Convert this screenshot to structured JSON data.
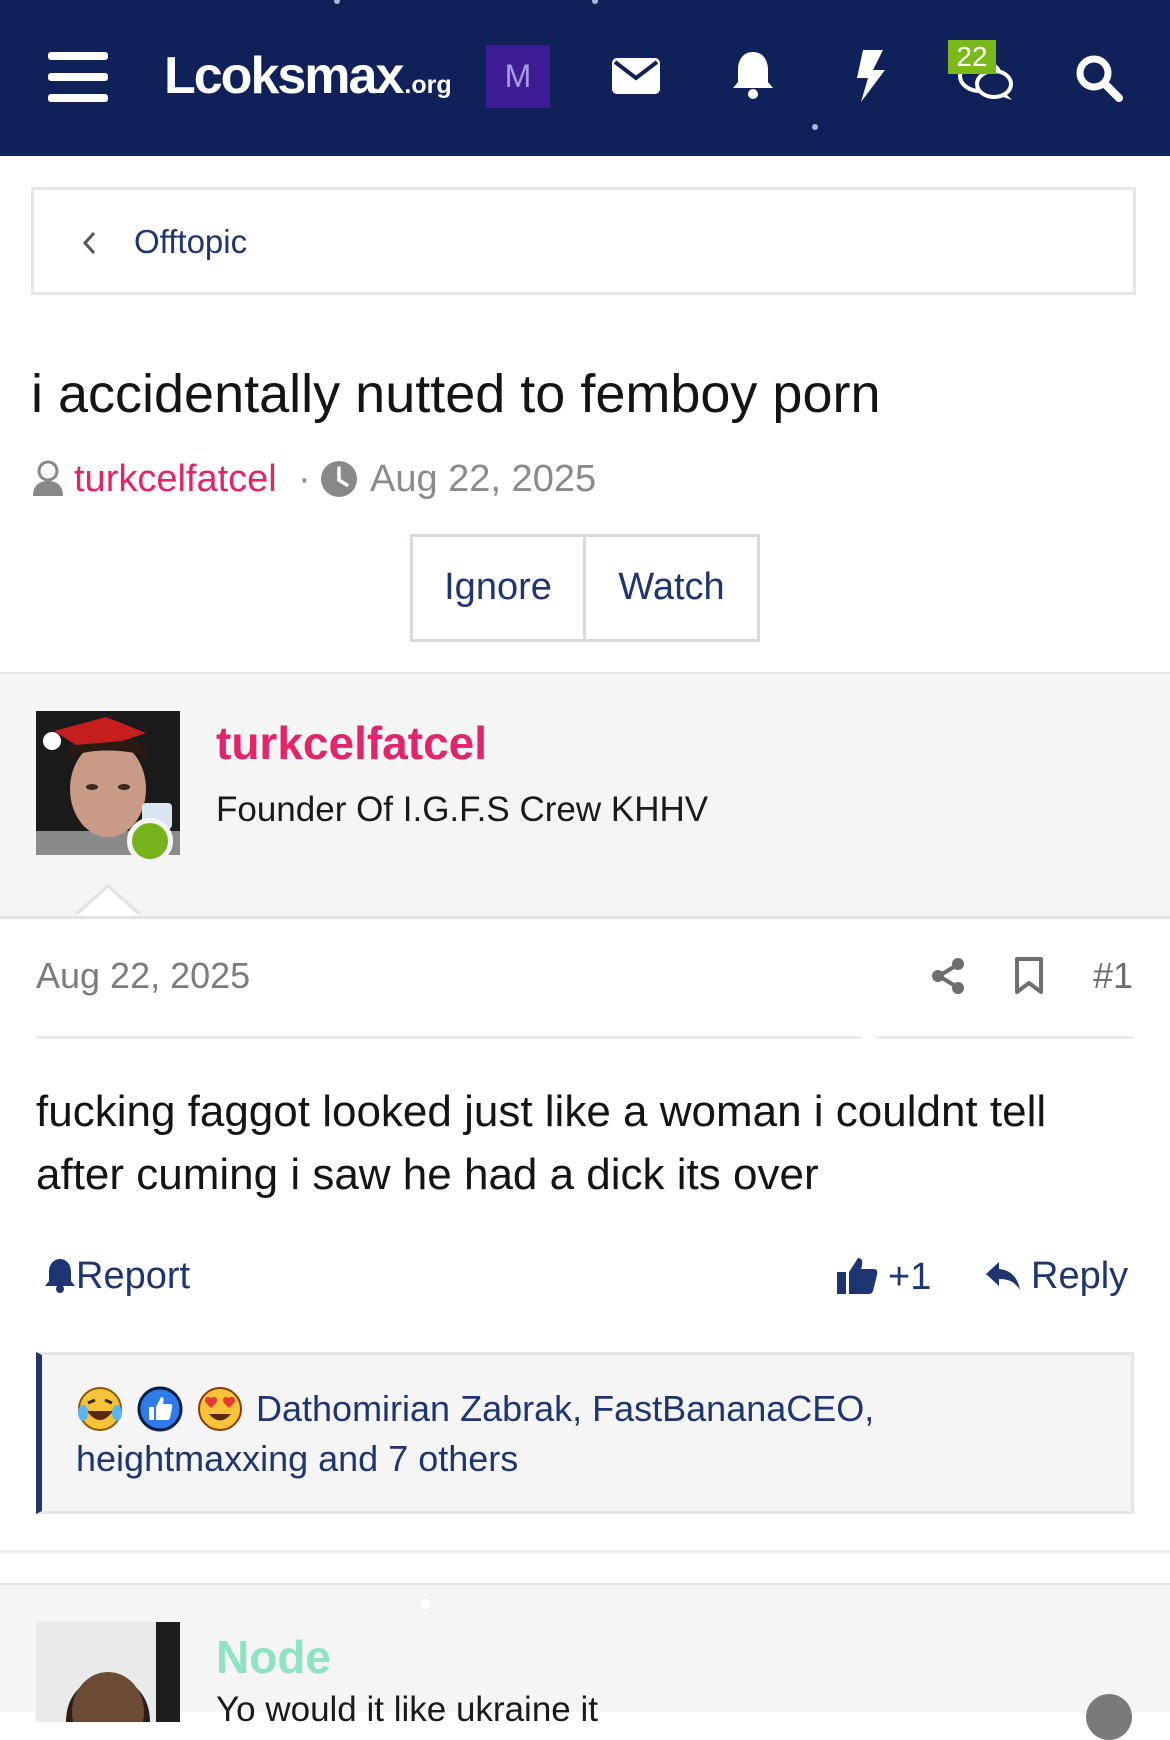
{
  "header": {
    "logo_text": "Lcoksmax",
    "logo_tld": ".org",
    "profile_badge": "M",
    "conversations_count": "22",
    "icons": [
      "menu-icon",
      "envelope-icon",
      "bell-icon",
      "bolt-icon",
      "chat-icon",
      "search-icon"
    ]
  },
  "breadcrumb": {
    "label": "Offtopic"
  },
  "thread": {
    "title": "i accidentally nutted to femboy porn",
    "author": "turkcelfatcel",
    "separator": "·",
    "date": "Aug 22, 2025",
    "buttons": {
      "ignore": "Ignore",
      "watch": "Watch"
    }
  },
  "post": {
    "username": "turkcelfatcel",
    "user_title": "Founder Of I.G.F.S Crew KHHV",
    "date": "Aug 22, 2025",
    "number": "#1",
    "body_line1": "fucking faggot looked just like a woman i couldnt tell",
    "body_line2": "after cuming i saw he had a dick its over",
    "actions": {
      "report": "Report",
      "like": "+1",
      "reply": "Reply"
    },
    "reactions_text": "Dathomirian Zabrak, FastBananaCEO, heightmaxxing and 7 others",
    "reaction_icons": [
      "laughing-emoji-icon",
      "like-emoji-icon",
      "heart-eyes-emoji-icon"
    ]
  },
  "post2": {
    "username": "Node",
    "user_title": "Yo would it like ukraine it"
  },
  "colors": {
    "header_bg": "#10215a",
    "accent_link": "#1d3570",
    "username_pink": "#e2246b",
    "online_green": "#78b21c",
    "badge_purple": "#3d1c93",
    "badge_green": "#7bb81a",
    "node_username": "#8ee3c1"
  }
}
